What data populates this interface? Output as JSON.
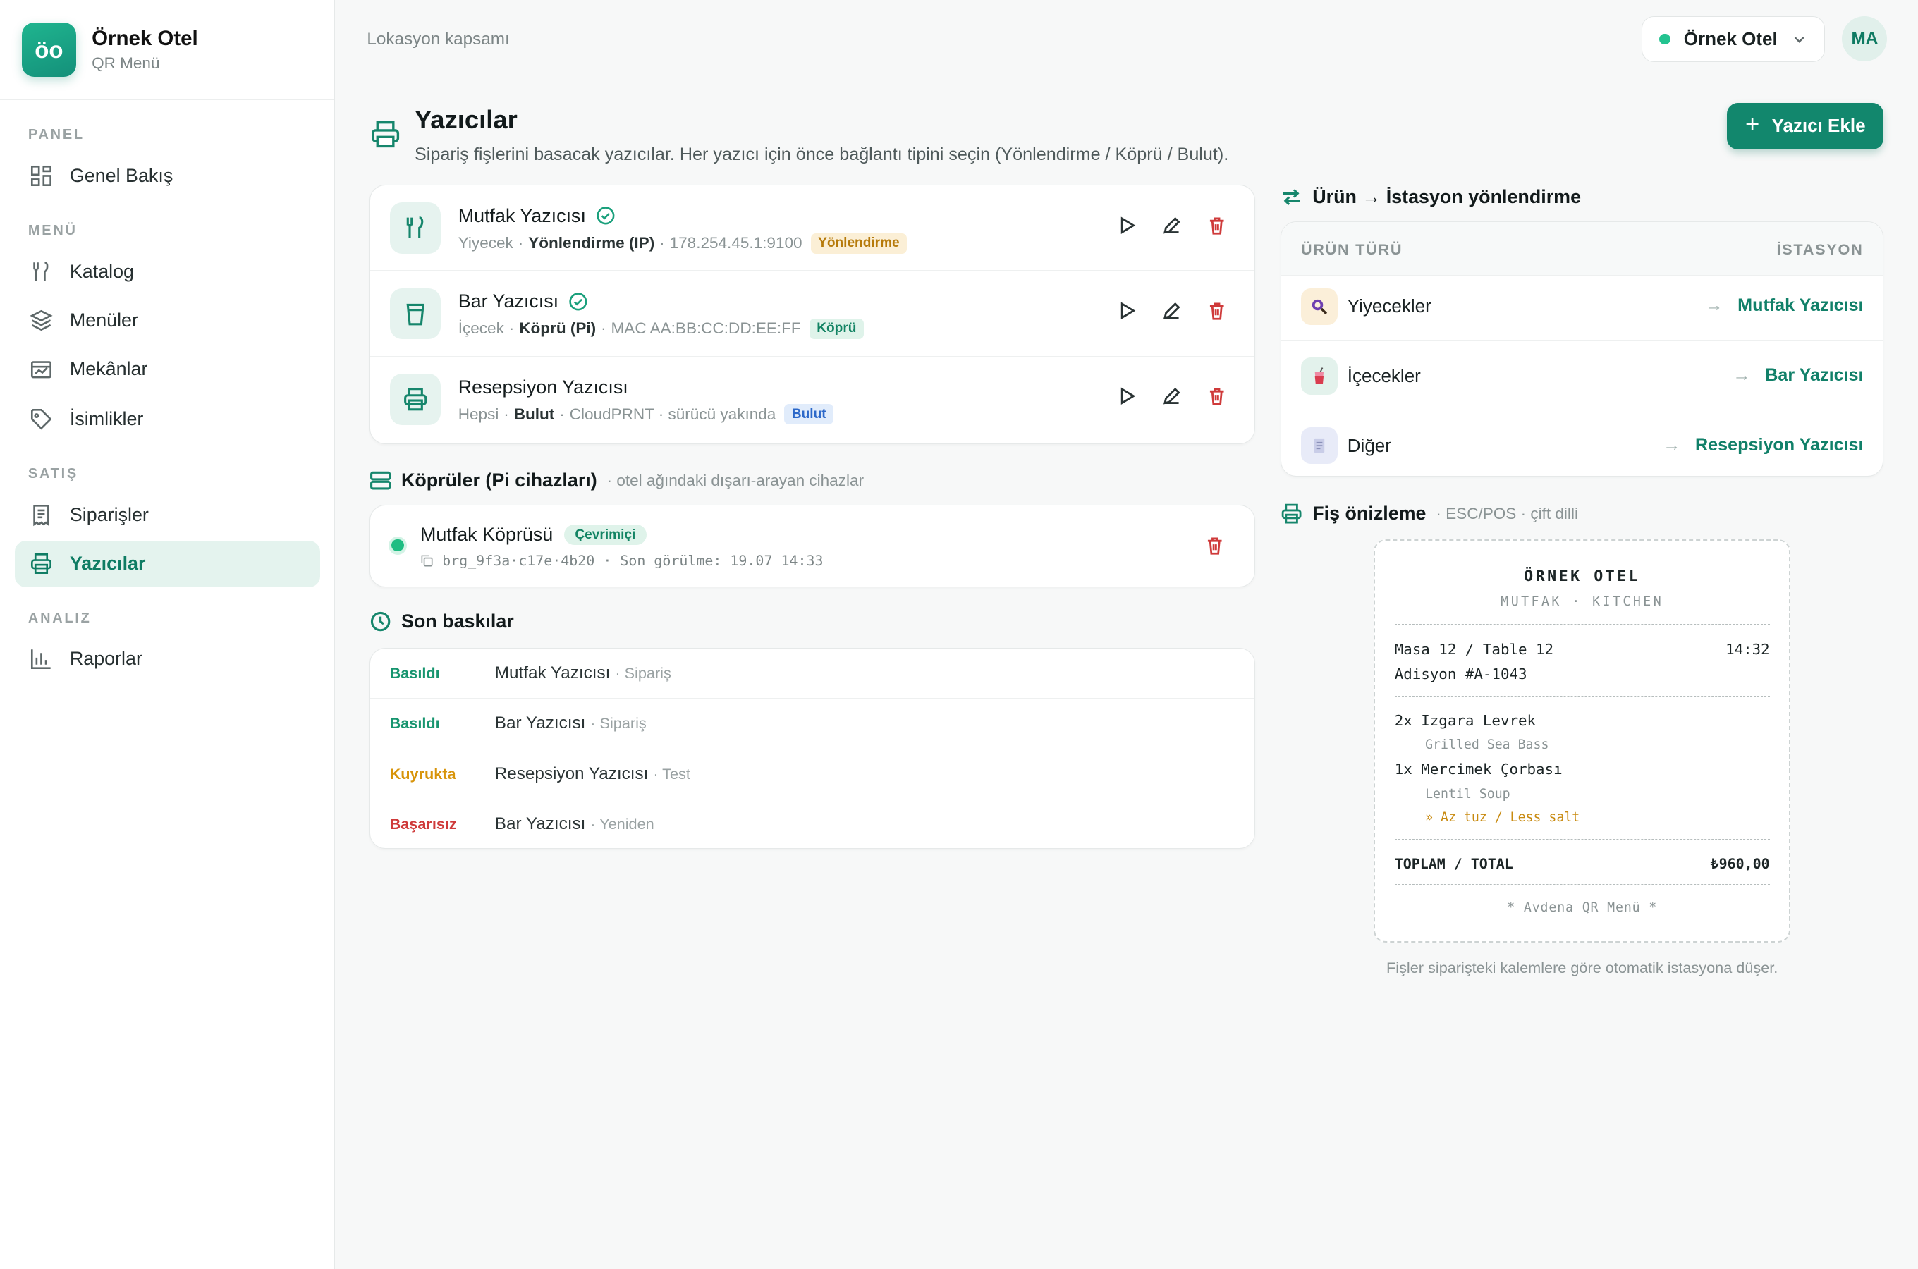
{
  "brand": {
    "logo": "öo",
    "name": "Örnek Otel",
    "subtitle": "QR Menü"
  },
  "sidebar": {
    "sections": [
      {
        "label": "PANEL"
      },
      {
        "label": "MENÜ"
      },
      {
        "label": "SATIŞ"
      },
      {
        "label": "ANALIZ"
      }
    ],
    "items": [
      {
        "label": "Genel Bakış",
        "icon": "grid-icon"
      },
      {
        "label": "Katalog",
        "icon": "utensils-icon"
      },
      {
        "label": "Menüler",
        "icon": "layers-icon"
      },
      {
        "label": "Mekânlar",
        "icon": "store-icon"
      },
      {
        "label": "İsimlikler",
        "icon": "tag-icon"
      },
      {
        "label": "Siparişler",
        "icon": "receipt-icon"
      },
      {
        "label": "Yazıcılar",
        "icon": "printer-icon",
        "active": true
      },
      {
        "label": "Raporlar",
        "icon": "bar-chart-icon"
      }
    ]
  },
  "topbar": {
    "scope": "Lokasyon kapsamı",
    "hotel": "Örnek Otel",
    "avatar": "MA"
  },
  "header": {
    "title": "Yazıcılar",
    "subtitle": "Sipariş fişlerini basacak yazıcılar. Her yazıcı için önce bağlantı tipini seçin (Yönlendirme / Köprü / Bulut).",
    "add_label": "Yazıcı Ekle"
  },
  "printers": [
    {
      "name": "Mutfak Yazıcısı",
      "verified": true,
      "category": "Yiyecek",
      "connection": "Yönlendirme (IP)",
      "address": "178.254.45.1:9100",
      "tag": "Yönlendirme",
      "icon": "utensils-icon"
    },
    {
      "name": "Bar Yazıcısı",
      "verified": true,
      "category": "İçecek",
      "connection": "Köprü (Pi)",
      "address": "MAC AA:BB:CC:DD:EE:FF",
      "tag": "Köprü",
      "icon": "cup-icon"
    },
    {
      "name": "Resepsiyon Yazıcısı",
      "verified": false,
      "category": "Hepsi",
      "connection": "Bulut",
      "address": "CloudPRNT · sürücü yakında",
      "tag": "Bulut",
      "icon": "printer-icon"
    }
  ],
  "bridges": {
    "title": "Köprüler (Pi cihazları)",
    "subtitle": "· otel ağındaki dışarı-arayan cihazlar",
    "items": [
      {
        "name": "Mutfak Köprüsü",
        "status": "Çevrimiçi",
        "id": "brg_9f3a·c17e·4b20",
        "seen": "· Son görülme: 19.07 14:33"
      }
    ]
  },
  "recent": {
    "title": "Son baskılar",
    "rows": [
      {
        "status": "Basıldı",
        "kind": "ok",
        "printer": "Mutfak Yazıcısı",
        "type": "· Sipariş"
      },
      {
        "status": "Basıldı",
        "kind": "ok",
        "printer": "Bar Yazıcısı",
        "type": "· Sipariş"
      },
      {
        "status": "Kuyrukta",
        "kind": "queue",
        "printer": "Resepsiyon Yazıcısı",
        "type": "· Test"
      },
      {
        "status": "Başarısız",
        "kind": "fail",
        "printer": "Bar Yazıcısı",
        "type": "· Yeniden"
      }
    ]
  },
  "routing": {
    "title": "Ürün → İstasyon yönlendirme",
    "col_type": "ÜRÜN TÜRÜ",
    "col_station": "İSTASYON",
    "rows": [
      {
        "type": "Yiyecekler",
        "station": "Mutfak Yazıcısı",
        "icon": "search-food-icon"
      },
      {
        "type": "İçecekler",
        "station": "Bar Yazıcısı",
        "icon": "drink-icon"
      },
      {
        "type": "Diğer",
        "station": "Resepsiyon Yazıcısı",
        "icon": "document-icon"
      }
    ]
  },
  "receipt": {
    "title": "Fiş önizleme",
    "subtitle": "· ESC/POS · çift dilli",
    "hotel": "ÖRNEK OTEL",
    "station": "MUTFAK · KITCHEN",
    "table": "Masa 12 / Table 12",
    "time": "14:32",
    "check": "Adisyon #A-1043",
    "lines": [
      {
        "qty_name": "2x Izgara Levrek",
        "translation": "Grilled Sea Bass"
      },
      {
        "qty_name": "1x Mercimek Çorbası",
        "translation": "Lentil Soup",
        "note": "» Az tuz / Less salt"
      }
    ],
    "total_label": "TOPLAM / TOTAL",
    "total_value": "₺960,00",
    "footer": "* Avdena QR Menü *",
    "caption": "Fişler siparişteki kalemlere göre otomatik istasyona düşer."
  },
  "colors": {
    "accent": "#12876d",
    "danger": "#cf3a3a",
    "warning": "#d8940a"
  }
}
